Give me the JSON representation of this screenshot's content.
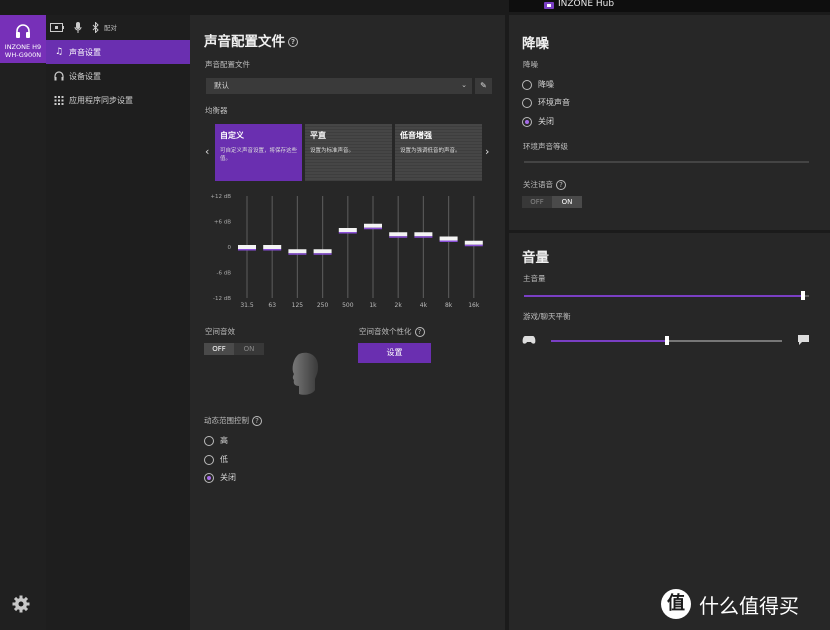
{
  "window": {
    "title": "INZONE Hub"
  },
  "device": {
    "name": "INZONE H9",
    "model": "WH-G900N"
  },
  "topbar": {
    "pair_label": "配对"
  },
  "nav": [
    {
      "label": "声音设置",
      "icon": "music-note-icon"
    },
    {
      "label": "设备设置",
      "icon": "headphones-icon"
    },
    {
      "label": "应用程序同步设置",
      "icon": "grid-icon"
    }
  ],
  "sound": {
    "title": "声音配置文件",
    "profile_label": "声音配置文件",
    "profile_value": "默认",
    "eq_label": "均衡器",
    "presets": [
      {
        "title": "自定义",
        "desc": "可自定义声音设置，将保存这些值。"
      },
      {
        "title": "平直",
        "desc": "设置为标准声音。"
      },
      {
        "title": "低音增强",
        "desc": "设置为强调低音的声音。"
      }
    ],
    "eq_y_ticks": [
      "+12 dB",
      "+6 dB",
      "0",
      "-6 dB",
      "-12 dB"
    ],
    "eq_bands": [
      {
        "freq": "31.5",
        "db": 0
      },
      {
        "freq": "63",
        "db": 0
      },
      {
        "freq": "125",
        "db": -1
      },
      {
        "freq": "250",
        "db": -1
      },
      {
        "freq": "500",
        "db": 4
      },
      {
        "freq": "1k",
        "db": 5
      },
      {
        "freq": "2k",
        "db": 3
      },
      {
        "freq": "4k",
        "db": 3
      },
      {
        "freq": "8k",
        "db": 2
      },
      {
        "freq": "16k",
        "db": 1
      }
    ],
    "spatial_label": "空间音效",
    "spatial_toggle": {
      "off": "OFF",
      "on": "ON",
      "state": "OFF"
    },
    "personalize_label": "空间音效个性化",
    "personalize_button": "设置",
    "drc_label": "动态范围控制",
    "drc_options": [
      "高",
      "低",
      "关闭"
    ],
    "drc_selected": "关闭"
  },
  "nc": {
    "title": "降噪",
    "mode_label": "降噪",
    "options": [
      "降噪",
      "环境声音",
      "关闭"
    ],
    "selected": "关闭",
    "ambient_label": "环境声音等级",
    "focus_label": "关注语音",
    "focus_toggle": {
      "off": "OFF",
      "on": "ON",
      "state": "ON"
    }
  },
  "volume": {
    "title": "音量",
    "master_label": "主音量",
    "master_level": 0.98,
    "balance_label": "游戏/聊天平衡",
    "balance_level": 0.5
  },
  "watermark": {
    "badge": "值",
    "text": "什么值得买"
  }
}
